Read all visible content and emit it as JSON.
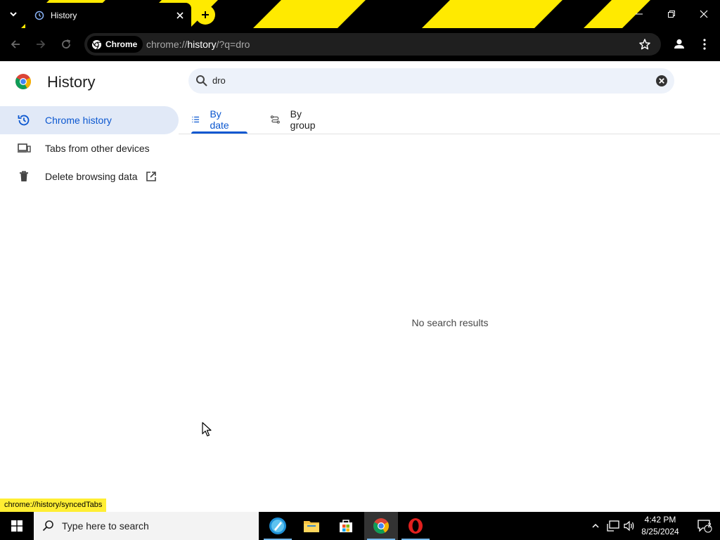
{
  "browser": {
    "tab": {
      "title": "History",
      "icon": "history-icon"
    },
    "omnibox": {
      "chip_label": "Chrome",
      "url_scheme": "chrome://",
      "url_host": "history",
      "url_path": "/?q=dro"
    },
    "status_url": "chrome://history/syncedTabs"
  },
  "page": {
    "title": "History",
    "search": {
      "value": "dro",
      "placeholder": ""
    },
    "sidebar": {
      "items": [
        {
          "label": "Chrome history",
          "icon": "history-icon",
          "active": true
        },
        {
          "label": "Tabs from other devices",
          "icon": "devices-icon",
          "active": false
        },
        {
          "label": "Delete browsing data",
          "icon": "trash-icon",
          "active": false
        }
      ]
    },
    "tabs": [
      {
        "label": "By date",
        "icon": "list-icon",
        "active": true
      },
      {
        "label": "By group",
        "icon": "journeys-icon",
        "active": false
      }
    ],
    "empty_message": "No search results"
  },
  "taskbar": {
    "search_placeholder": "Type here to search",
    "apps": [
      "app-launcher-icon",
      "file-explorer-icon",
      "microsoft-store-icon",
      "chrome-icon",
      "opera-icon"
    ],
    "clock": {
      "time": "4:42 PM",
      "date": "8/25/2024"
    },
    "notification_count": "2"
  },
  "colors": {
    "accent": "#0b57d0",
    "active_item_bg": "#e1e9f7",
    "stripe_yellow": "#ffea00",
    "status_yellow": "#ffee33"
  }
}
